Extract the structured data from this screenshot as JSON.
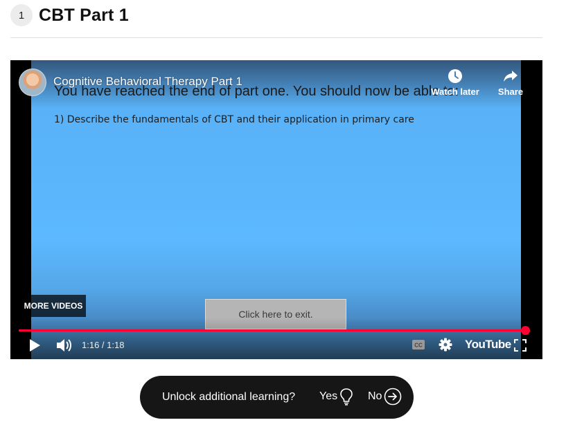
{
  "header": {
    "step_number": "1",
    "title": "CBT Part 1"
  },
  "player": {
    "slide_heading": "You have reached the end of part one. You should now be able to:",
    "slide_point": "1) Describe the fundamentals of CBT and their application in primary care",
    "video_title": "Cognitive Behavioral Therapy Part 1",
    "watch_later_label": "Watch later",
    "share_label": "Share",
    "more_videos_label": "MORE VIDEOS",
    "exit_button_label": "Click here to exit.",
    "current_time": "1:16",
    "time_separator": " / ",
    "duration": "1:18",
    "progress_fraction": 0.987,
    "brand_label": "YouTube",
    "accent_color": "#ff0033"
  },
  "prompt": {
    "question": "Unlock additional learning?",
    "yes_label": "Yes",
    "no_label": "No",
    "icons": {
      "yes": "lightbulb-icon",
      "no": "arrow-right-circle-icon"
    }
  }
}
